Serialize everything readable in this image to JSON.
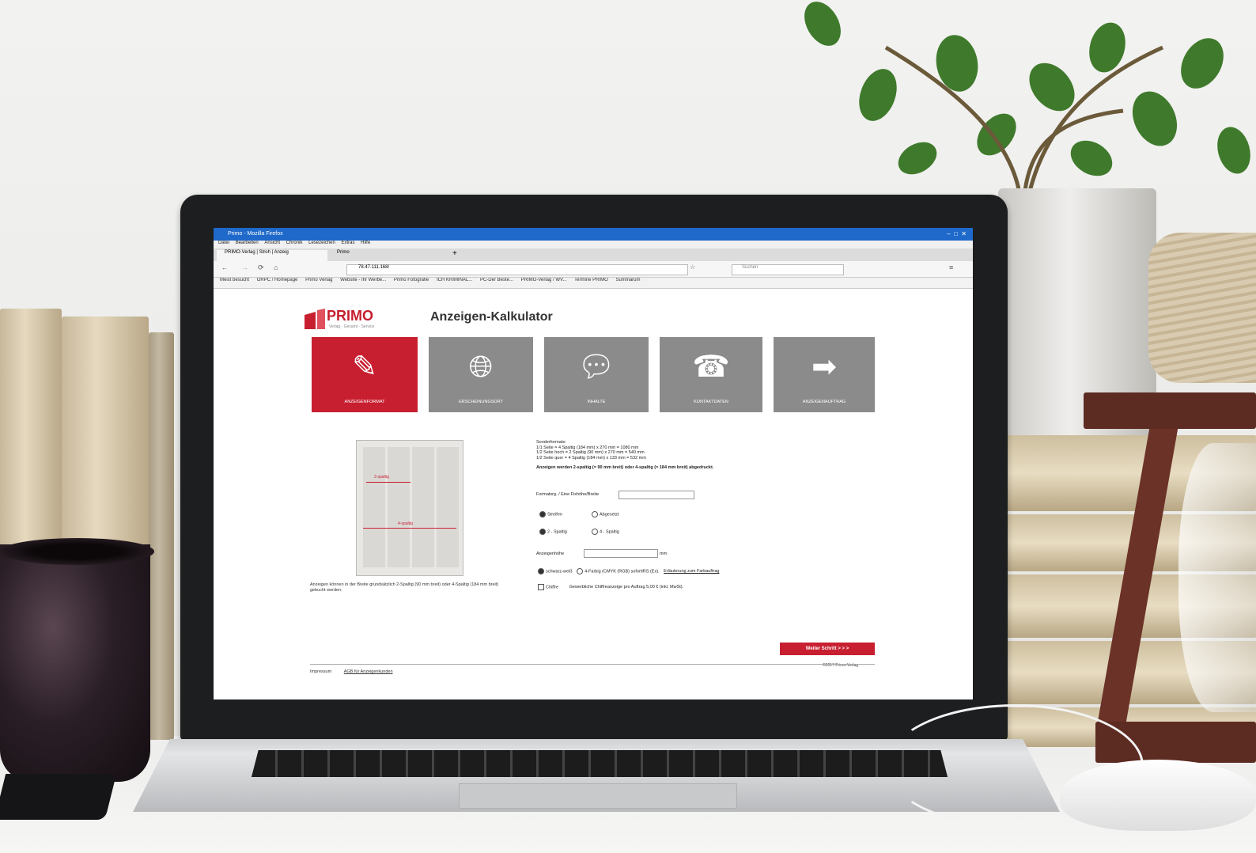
{
  "browser": {
    "window_title": "Primo - Mozilla Firefox",
    "menu": [
      "Datei",
      "Bearbeiten",
      "Ansicht",
      "Chronik",
      "Lesezeichen",
      "Extras",
      "Hilfe"
    ],
    "tabs": [
      {
        "label": "PRIMO-Verlag | Stroh | Anzeig"
      },
      {
        "label": "Primo"
      }
    ],
    "url": "78.47.111.168/",
    "search_placeholder": "Suchen",
    "bookmarks": [
      "Meist besucht",
      "ORPC / Homepage",
      "Primo Verlag",
      "Website - Ihr Werbe...",
      "Primo Fotografie",
      "ICH KRIMINAL...",
      "PC-Der Beste...",
      "PRIMO-Verlag / WV...",
      "Termine PRIMO",
      "Summarum"
    ]
  },
  "page": {
    "logo_text": "PRIMO",
    "logo_sub": "Verlag · Gesamt · Service",
    "title": "Anzeigen-Kalkulator",
    "tiles": [
      {
        "label": "ANZEIGENFORMAT",
        "icon": "pen-icon",
        "active": true
      },
      {
        "label": "ERSCHEINUNGSORT",
        "icon": "globe-icon",
        "active": false
      },
      {
        "label": "INHALTE",
        "icon": "speech-bubble-icon",
        "active": false
      },
      {
        "label": "KONTAKTDATEN",
        "icon": "telephone-icon",
        "active": false
      },
      {
        "label": "ANZEIGENAUFTRAG",
        "icon": "arrow-right-icon",
        "active": false
      }
    ],
    "preview": {
      "label_small": "2-spaltig",
      "label_large": "4-spaltig"
    },
    "preview_caption": "Anzeigen können in der Breite grundsätzlich 2-Spaltig (90 mm breit) oder 4-Spaltig (184 mm breit) gebucht werden.",
    "info": {
      "heading": "Sonderformate:",
      "lines": [
        "1/1 Seite = 4 Spaltig (184 mm) x 270 mm = 1080 mm",
        "1/2 Seite hoch = 2 Spaltig (90 mm) x 270 mm = 540 mm",
        "1/2 Seite quer = 4 Spaltig (184 mm) x 133 mm = 532 mm"
      ],
      "note": "Anzeigen werden 2-spaltig (= 90 mm breit) oder 4-spaltig (= 184 mm breit) abgedruckt."
    },
    "form": {
      "format_label": "Formatsrg. / Eine Fixhöhe/Breite",
      "format_value": "",
      "radio_row1": [
        {
          "label": "Streifen",
          "checked": true
        },
        {
          "label": "Abgesetzt",
          "checked": false
        }
      ],
      "radio_row2": [
        {
          "label": "2 - Spaltig",
          "checked": true
        },
        {
          "label": "4 - Spaltig",
          "checked": false
        }
      ],
      "height_label": "Anzeigenhöhe",
      "height_value": "",
      "height_unit": "mm",
      "color_option_1": "schwarz-weiß",
      "color_option_2": "4-Farbig (CMYK (RGB) sofortIRS (Ex).",
      "color_link": "Erläuterung zum Farbauftrag",
      "extra_checkbox": "Chiffre",
      "extra_text": "Gewerbliche Chiffreanzeige pro Auftrag 5,00 € (inkl. MwSt)."
    },
    "next_button": "Weiter Schritt  > > >",
    "footer_links": [
      "Impressum",
      "AGB für Anzeigenkunden"
    ],
    "copyright": "©2017 Primo-Verlag"
  },
  "colors": {
    "brand_red": "#c81f30",
    "tile_gray": "#8b8b8b",
    "titlebar_blue": "#1e69c9"
  }
}
